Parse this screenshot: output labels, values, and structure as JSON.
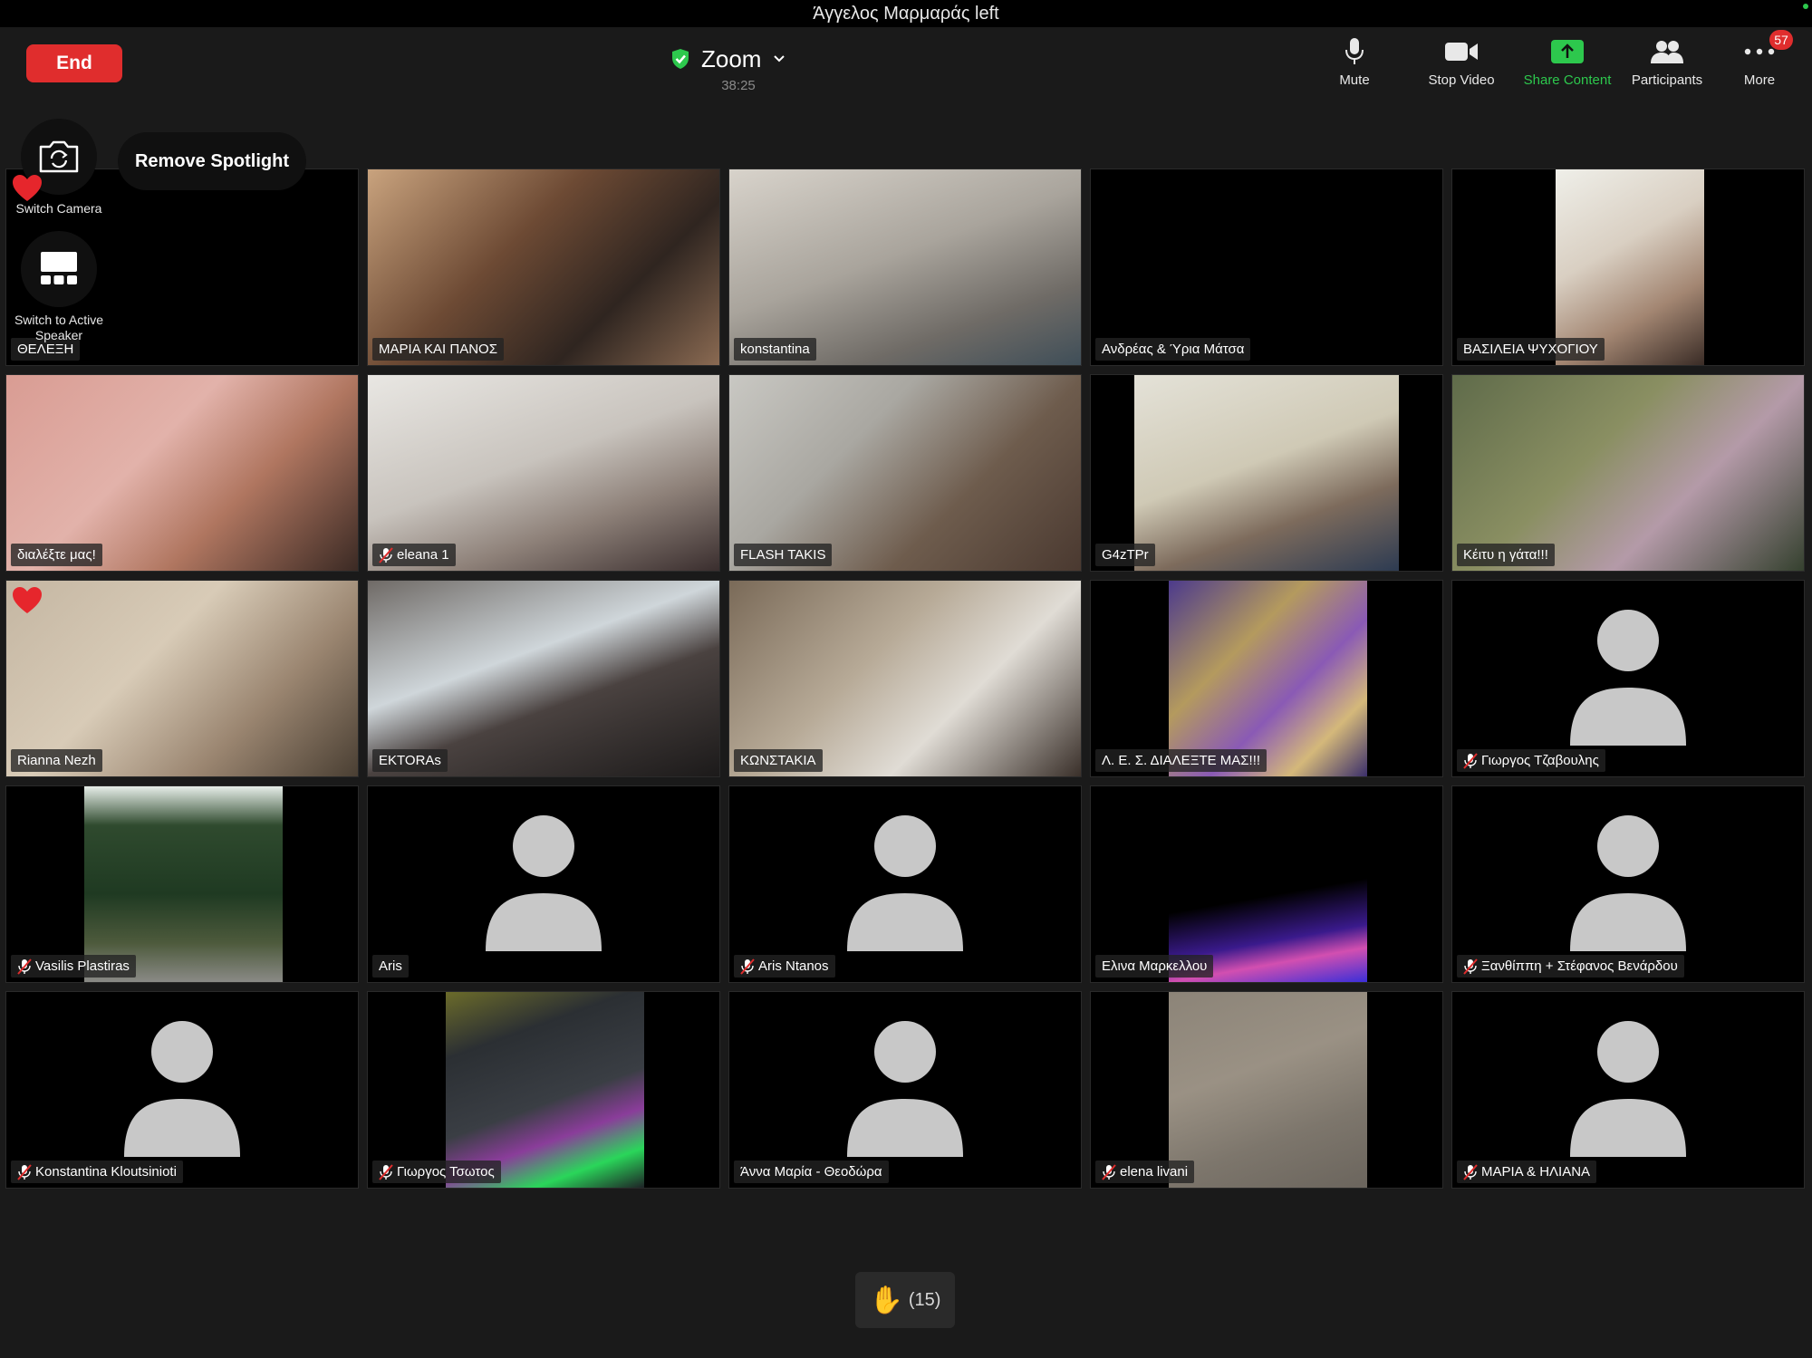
{
  "top_notice": "Άγγελος Μαρμαράς left",
  "header": {
    "end_label": "End",
    "meeting_title": "Zoom",
    "timer": "38:25"
  },
  "toolbar": {
    "mute": "Mute",
    "stop_video": "Stop Video",
    "share_content": "Share Content",
    "participants": "Participants",
    "more": "More",
    "more_badge": "57"
  },
  "overlay": {
    "switch_camera": "Switch Camera",
    "remove_spotlight": "Remove Spotlight",
    "switch_speaker": "Switch to Active Speaker"
  },
  "participants": [
    {
      "name": "ΘΕΛΕΞΗ",
      "muted": false,
      "bg": "none"
    },
    {
      "name": "ΜΑΡΙΑ ΚΑΙ ΠΑΝΟΣ",
      "muted": false,
      "bg": "video"
    },
    {
      "name": "konstantina",
      "muted": false,
      "bg": "video"
    },
    {
      "name": "Ανδρέας & Ύρια Μάτσα",
      "muted": false,
      "bg": "none"
    },
    {
      "name": "ΒΑΣΙΛΕΙΑ ΨΥΧΟΓΙΟΥ",
      "muted": false,
      "bg": "video"
    },
    {
      "name": "διαλέξτε μας!",
      "muted": false,
      "bg": "video"
    },
    {
      "name": "eleana 1",
      "muted": true,
      "bg": "video"
    },
    {
      "name": "FLASH TAKIS",
      "muted": false,
      "bg": "video"
    },
    {
      "name": "G4zTPr",
      "muted": false,
      "bg": "video"
    },
    {
      "name": "Κέιτυ η γάτα!!!",
      "muted": false,
      "bg": "video"
    },
    {
      "name": "Rianna Nezh",
      "muted": false,
      "bg": "video"
    },
    {
      "name": "EKTORAs",
      "muted": false,
      "bg": "video"
    },
    {
      "name": "ΚΩΝΣΤΑΚΙΑ",
      "muted": false,
      "bg": "video"
    },
    {
      "name": "Λ. Ε. Σ. ΔΙΑΛΕΞΤΕ ΜΑΣ!!!",
      "muted": false,
      "bg": "video"
    },
    {
      "name": "Γιωργος Τζαβουλης",
      "muted": true,
      "bg": "avatar"
    },
    {
      "name": "Vasilis Plastiras",
      "muted": true,
      "bg": "video"
    },
    {
      "name": "Aris",
      "muted": false,
      "bg": "avatar"
    },
    {
      "name": "Aris Ntanos",
      "muted": true,
      "bg": "avatar"
    },
    {
      "name": "Ελινα Μαρκελλου",
      "muted": false,
      "bg": "video"
    },
    {
      "name": "Ξανθίππη + Στέφανος Βενάρδου",
      "muted": true,
      "bg": "avatar"
    },
    {
      "name": "Konstantina Kloutsinioti",
      "muted": true,
      "bg": "avatar"
    },
    {
      "name": "Γιωργος Τσωτος",
      "muted": true,
      "bg": "video"
    },
    {
      "name": "Άννα Μαρία - Θεοδώρα",
      "muted": false,
      "bg": "avatar"
    },
    {
      "name": "elena livani",
      "muted": true,
      "bg": "video"
    },
    {
      "name": "ΜΑΡΙΑ & ΗΛΙΑΝΑ",
      "muted": true,
      "bg": "avatar"
    }
  ],
  "raised_hands": "(15)",
  "colors": {
    "end": "#e02d2d",
    "share_green": "#2dc84d",
    "mute_red": "#e02d2d"
  }
}
